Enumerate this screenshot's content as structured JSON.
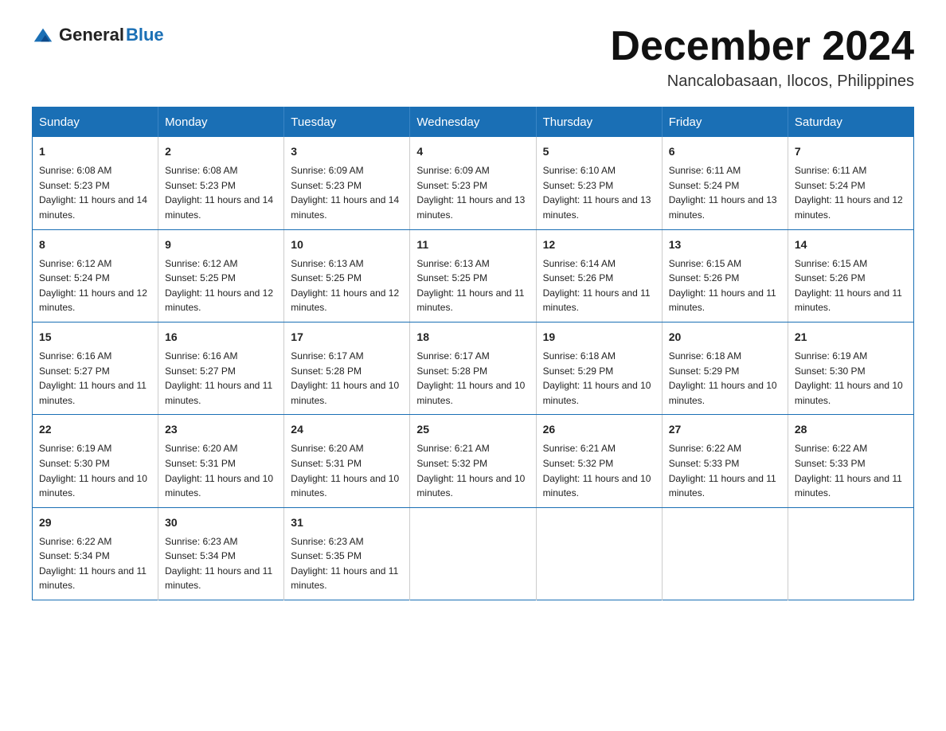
{
  "header": {
    "logo": {
      "general": "General",
      "blue": "Blue"
    },
    "title": "December 2024",
    "subtitle": "Nancalobasaan, Ilocos, Philippines"
  },
  "days_of_week": [
    "Sunday",
    "Monday",
    "Tuesday",
    "Wednesday",
    "Thursday",
    "Friday",
    "Saturday"
  ],
  "weeks": [
    [
      {
        "day": "1",
        "sunrise": "6:08 AM",
        "sunset": "5:23 PM",
        "daylight": "11 hours and 14 minutes."
      },
      {
        "day": "2",
        "sunrise": "6:08 AM",
        "sunset": "5:23 PM",
        "daylight": "11 hours and 14 minutes."
      },
      {
        "day": "3",
        "sunrise": "6:09 AM",
        "sunset": "5:23 PM",
        "daylight": "11 hours and 14 minutes."
      },
      {
        "day": "4",
        "sunrise": "6:09 AM",
        "sunset": "5:23 PM",
        "daylight": "11 hours and 13 minutes."
      },
      {
        "day": "5",
        "sunrise": "6:10 AM",
        "sunset": "5:23 PM",
        "daylight": "11 hours and 13 minutes."
      },
      {
        "day": "6",
        "sunrise": "6:11 AM",
        "sunset": "5:24 PM",
        "daylight": "11 hours and 13 minutes."
      },
      {
        "day": "7",
        "sunrise": "6:11 AM",
        "sunset": "5:24 PM",
        "daylight": "11 hours and 12 minutes."
      }
    ],
    [
      {
        "day": "8",
        "sunrise": "6:12 AM",
        "sunset": "5:24 PM",
        "daylight": "11 hours and 12 minutes."
      },
      {
        "day": "9",
        "sunrise": "6:12 AM",
        "sunset": "5:25 PM",
        "daylight": "11 hours and 12 minutes."
      },
      {
        "day": "10",
        "sunrise": "6:13 AM",
        "sunset": "5:25 PM",
        "daylight": "11 hours and 12 minutes."
      },
      {
        "day": "11",
        "sunrise": "6:13 AM",
        "sunset": "5:25 PM",
        "daylight": "11 hours and 11 minutes."
      },
      {
        "day": "12",
        "sunrise": "6:14 AM",
        "sunset": "5:26 PM",
        "daylight": "11 hours and 11 minutes."
      },
      {
        "day": "13",
        "sunrise": "6:15 AM",
        "sunset": "5:26 PM",
        "daylight": "11 hours and 11 minutes."
      },
      {
        "day": "14",
        "sunrise": "6:15 AM",
        "sunset": "5:26 PM",
        "daylight": "11 hours and 11 minutes."
      }
    ],
    [
      {
        "day": "15",
        "sunrise": "6:16 AM",
        "sunset": "5:27 PM",
        "daylight": "11 hours and 11 minutes."
      },
      {
        "day": "16",
        "sunrise": "6:16 AM",
        "sunset": "5:27 PM",
        "daylight": "11 hours and 11 minutes."
      },
      {
        "day": "17",
        "sunrise": "6:17 AM",
        "sunset": "5:28 PM",
        "daylight": "11 hours and 10 minutes."
      },
      {
        "day": "18",
        "sunrise": "6:17 AM",
        "sunset": "5:28 PM",
        "daylight": "11 hours and 10 minutes."
      },
      {
        "day": "19",
        "sunrise": "6:18 AM",
        "sunset": "5:29 PM",
        "daylight": "11 hours and 10 minutes."
      },
      {
        "day": "20",
        "sunrise": "6:18 AM",
        "sunset": "5:29 PM",
        "daylight": "11 hours and 10 minutes."
      },
      {
        "day": "21",
        "sunrise": "6:19 AM",
        "sunset": "5:30 PM",
        "daylight": "11 hours and 10 minutes."
      }
    ],
    [
      {
        "day": "22",
        "sunrise": "6:19 AM",
        "sunset": "5:30 PM",
        "daylight": "11 hours and 10 minutes."
      },
      {
        "day": "23",
        "sunrise": "6:20 AM",
        "sunset": "5:31 PM",
        "daylight": "11 hours and 10 minutes."
      },
      {
        "day": "24",
        "sunrise": "6:20 AM",
        "sunset": "5:31 PM",
        "daylight": "11 hours and 10 minutes."
      },
      {
        "day": "25",
        "sunrise": "6:21 AM",
        "sunset": "5:32 PM",
        "daylight": "11 hours and 10 minutes."
      },
      {
        "day": "26",
        "sunrise": "6:21 AM",
        "sunset": "5:32 PM",
        "daylight": "11 hours and 10 minutes."
      },
      {
        "day": "27",
        "sunrise": "6:22 AM",
        "sunset": "5:33 PM",
        "daylight": "11 hours and 11 minutes."
      },
      {
        "day": "28",
        "sunrise": "6:22 AM",
        "sunset": "5:33 PM",
        "daylight": "11 hours and 11 minutes."
      }
    ],
    [
      {
        "day": "29",
        "sunrise": "6:22 AM",
        "sunset": "5:34 PM",
        "daylight": "11 hours and 11 minutes."
      },
      {
        "day": "30",
        "sunrise": "6:23 AM",
        "sunset": "5:34 PM",
        "daylight": "11 hours and 11 minutes."
      },
      {
        "day": "31",
        "sunrise": "6:23 AM",
        "sunset": "5:35 PM",
        "daylight": "11 hours and 11 minutes."
      },
      null,
      null,
      null,
      null
    ]
  ]
}
